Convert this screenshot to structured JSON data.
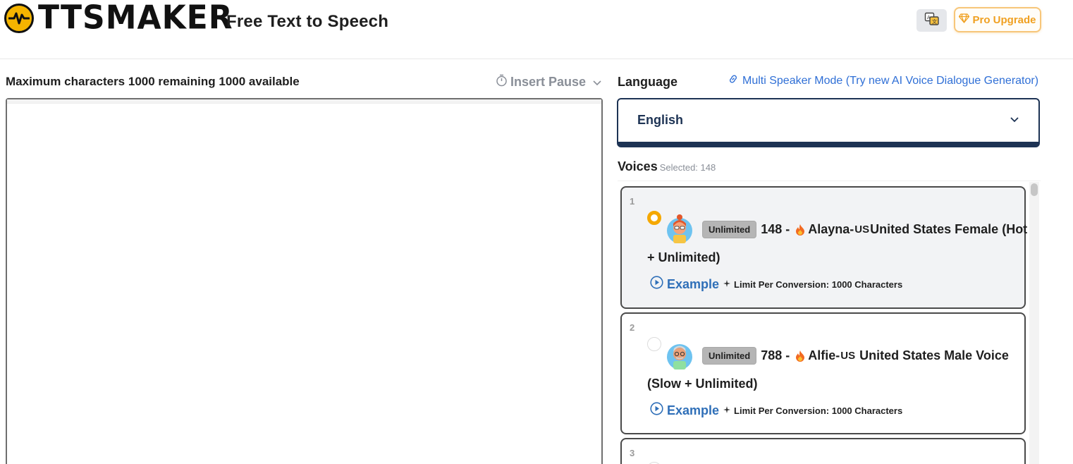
{
  "header": {
    "logo_text": "TTSMAKER",
    "tagline": "Free Text to Speech",
    "pro_label": "Pro Upgrade",
    "colors": {
      "logo_accent": "#f5b400",
      "pro": "#f0a020"
    }
  },
  "editor": {
    "char_info": "Maximum characters 1000 remaining 1000 available",
    "insert_pause_label": "Insert Pause",
    "text_value": ""
  },
  "language": {
    "label": "Language",
    "multi_speaker_link": "Multi Speaker Mode (Try new AI Voice Dialogue Generator)",
    "selected": "English"
  },
  "voices": {
    "label": "Voices",
    "selected_text": "Selected: 148",
    "items": [
      {
        "index": "1",
        "badge": "Unlimited",
        "id_prefix": "148 -",
        "name": "Alayna-",
        "country_code": "US",
        "title_rest": "United States Female (Hot",
        "title_line2": "+ Unlimited)",
        "example_label": "Example",
        "limit_text": "Limit Per Conversion: 1000 Characters",
        "selected": true
      },
      {
        "index": "2",
        "badge": "Unlimited",
        "id_prefix": "788 -",
        "name": "Alfie-",
        "country_code": "US",
        "title_rest": " United States Male Voice",
        "title_line2": "(Slow + Unlimited)",
        "example_label": "Example",
        "limit_text": "Limit Per Conversion: 1000 Characters",
        "selected": false
      },
      {
        "index": "3"
      }
    ]
  }
}
